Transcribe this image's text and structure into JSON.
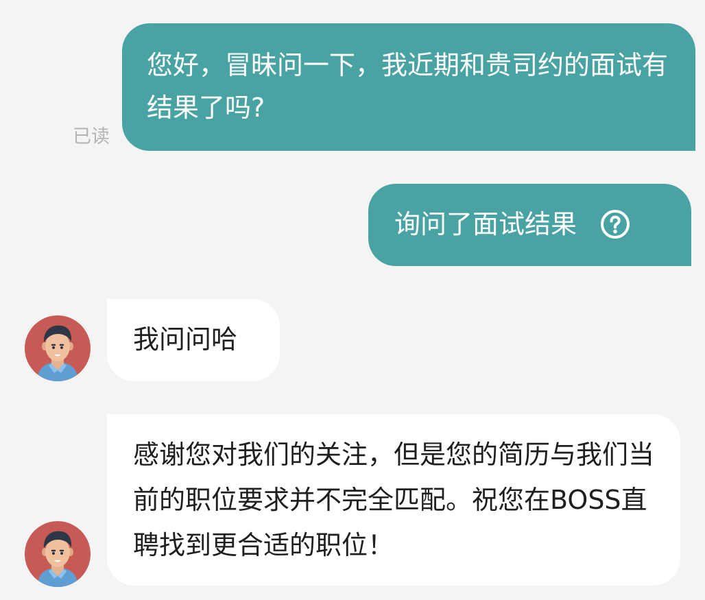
{
  "messages": [
    {
      "id": 1,
      "direction": "outgoing",
      "text": "您好，冒昧问一下，我近期和贵司约的面试有结果了吗?",
      "read_status": "已读"
    },
    {
      "id": 2,
      "direction": "outgoing",
      "text": "询问了面试结果",
      "icon": "help-circle-icon"
    },
    {
      "id": 3,
      "direction": "incoming",
      "text": "我问问哈",
      "avatar": "recruiter-avatar"
    },
    {
      "id": 4,
      "direction": "incoming",
      "text": "感谢您对我们的关注，但是您的简历与我们当前的职位要求并不完全匹配。祝您在BOSS直聘找到更合适的职位！",
      "avatar": "recruiter-avatar"
    }
  ],
  "colors": {
    "background": "#f4f4f4",
    "outgoing_bubble": "#4aa3a3",
    "incoming_bubble": "#ffffff",
    "avatar_background": "#c85a56",
    "read_status": "#b4b4b4"
  }
}
